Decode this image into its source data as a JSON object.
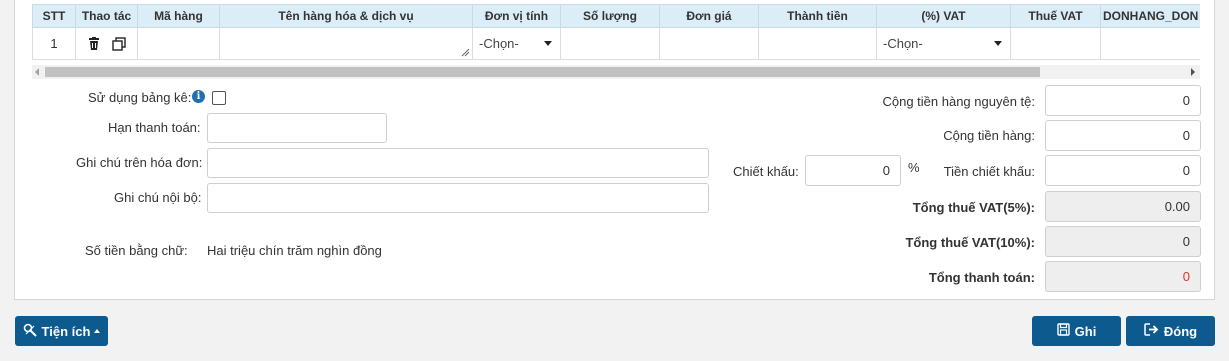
{
  "table": {
    "headers": [
      "STT",
      "Thao tác",
      "Mã hàng",
      "Tên hàng hóa & dịch vụ",
      "Đơn vị tính",
      "Số lượng",
      "Đơn giá",
      "Thành tiền",
      "(%) VAT",
      "Thuế VAT",
      "DONHANG_DON"
    ],
    "row": {
      "stt": "1",
      "don_vi_tinh": "-Chọn-",
      "vat": "-Chọn-"
    }
  },
  "form_left": {
    "su_dung_bang_ke": "Sử dụng bảng kê:",
    "han_thanh_toan": "Hạn thanh toán:",
    "ghi_chu_hoa_don": "Ghi chú trên hóa đơn:",
    "ghi_chu_noi_bo": "Ghi chú nội bộ:",
    "so_tien_bang_chu_label": "Số tiền bằng chữ:",
    "so_tien_bang_chu_value": "Hai triệu chín trăm nghìn đồng"
  },
  "discount": {
    "label": "Chiết khấu:",
    "value": "0",
    "unit": "%"
  },
  "totals": {
    "cong_tien_hang_nguyen_te": {
      "label": "Cộng tiền hàng nguyên tệ:",
      "value": "0"
    },
    "cong_tien_hang": {
      "label": "Cộng tiền hàng:",
      "value": "0"
    },
    "tien_chiet_khau": {
      "label": "Tiền chiết khấu:",
      "value": "0"
    },
    "tong_thue_vat5": {
      "label": "Tổng thuế VAT(5%):",
      "value": "0.00"
    },
    "tong_thue_vat10": {
      "label": "Tổng thuế VAT(10%):",
      "value": "0"
    },
    "tong_thanh_toan": {
      "label": "Tổng thanh toán:",
      "value": "0"
    }
  },
  "buttons": {
    "tien_ich": "Tiện ích",
    "ghi": "Ghi",
    "dong": "Đóng"
  },
  "colors": {
    "header_bg": "#dbeef8",
    "button": "#0d5a8e",
    "total_red": "#e0302c"
  }
}
